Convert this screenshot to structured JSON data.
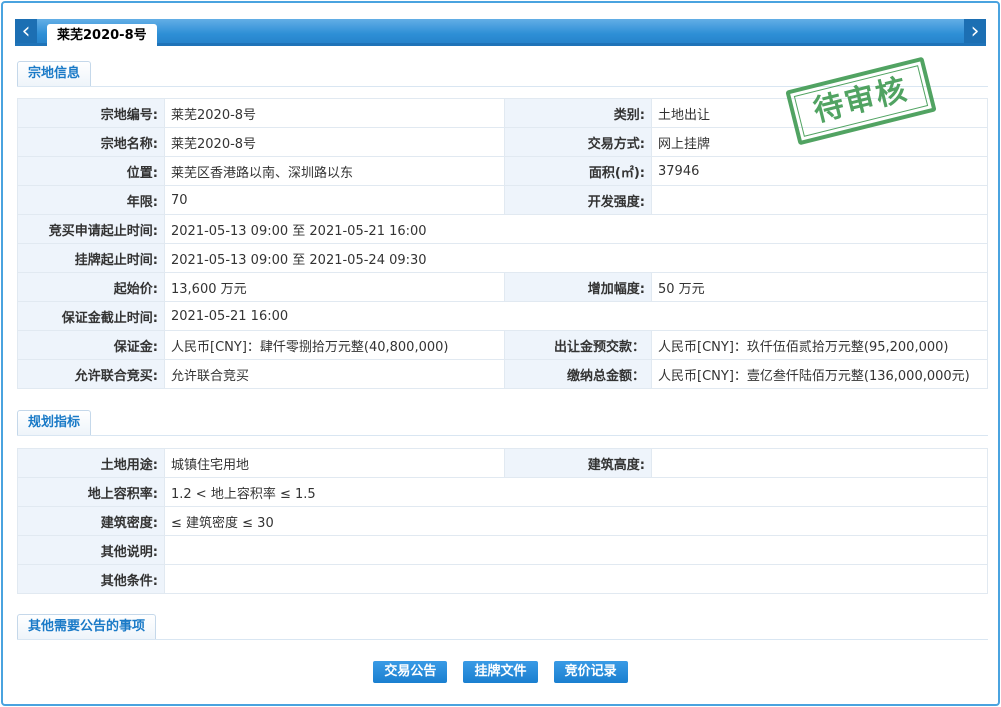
{
  "tab": {
    "prev_arrow": "‹",
    "next_arrow": "›",
    "active_label": "莱芜2020-8号"
  },
  "stamp": {
    "text": "待审核",
    "color": "#3f9a52"
  },
  "sections": {
    "parcel": "宗地信息",
    "planning": "规划指标",
    "other": "其他需要公告的事项"
  },
  "parcel": {
    "rows": [
      {
        "l1": "宗地编号:",
        "v1": "莱芜2020-8号",
        "l2": "类别:",
        "v2": "土地出让"
      },
      {
        "l1": "宗地名称:",
        "v1": "莱芜2020-8号",
        "l2": "交易方式:",
        "v2": "网上挂牌"
      },
      {
        "l1": "位置:",
        "v1": "莱芜区香港路以南、深圳路以东",
        "l2": "面积(㎡):",
        "v2": "37946"
      },
      {
        "l1": "年限:",
        "v1": "70",
        "l2": "开发强度:",
        "v2": ""
      },
      {
        "l1": "竞买申请起止时间:",
        "v1": "2021-05-13 09:00 至 2021-05-21 16:00"
      },
      {
        "l1": "挂牌起止时间:",
        "v1": "2021-05-13 09:00 至 2021-05-24 09:30"
      },
      {
        "l1": "起始价:",
        "v1": "13,600 万元",
        "l2": "增加幅度:",
        "v2": "50 万元"
      },
      {
        "l1": "保证金截止时间:",
        "v1": "2021-05-21 16:00"
      },
      {
        "l1": "保证金:",
        "v1": "人民币[CNY]：肆仟零捌拾万元整(40,800,000)",
        "l2": "出让金预交款：",
        "v2": "人民币[CNY]：玖仟伍佰贰拾万元整(95,200,000)"
      },
      {
        "l1": "允许联合竞买:",
        "v1": "允许联合竞买",
        "l2": "缴纳总金额：",
        "v2": "人民币[CNY]：壹亿叁仟陆佰万元整(136,000,000元)"
      }
    ]
  },
  "planning": {
    "rows": [
      {
        "l1": "土地用途:",
        "v1": "城镇住宅用地",
        "l2": "建筑高度:",
        "v2": ""
      },
      {
        "l1": "地上容积率:",
        "v1": "1.2 < 地上容积率 ≤ 1.5"
      },
      {
        "l1": "建筑密度:",
        "v1": "≤ 建筑密度 ≤ 30"
      },
      {
        "l1": "其他说明:",
        "v1": ""
      },
      {
        "l1": "其他条件:",
        "v1": ""
      }
    ]
  },
  "buttons": {
    "announcement": "交易公告",
    "listing_docs": "挂牌文件",
    "bid_records": "竞价记录"
  },
  "colors": {
    "accent": "#2e8fd6",
    "frame": "#4aa3df",
    "label_bg": "#eef4fb"
  }
}
